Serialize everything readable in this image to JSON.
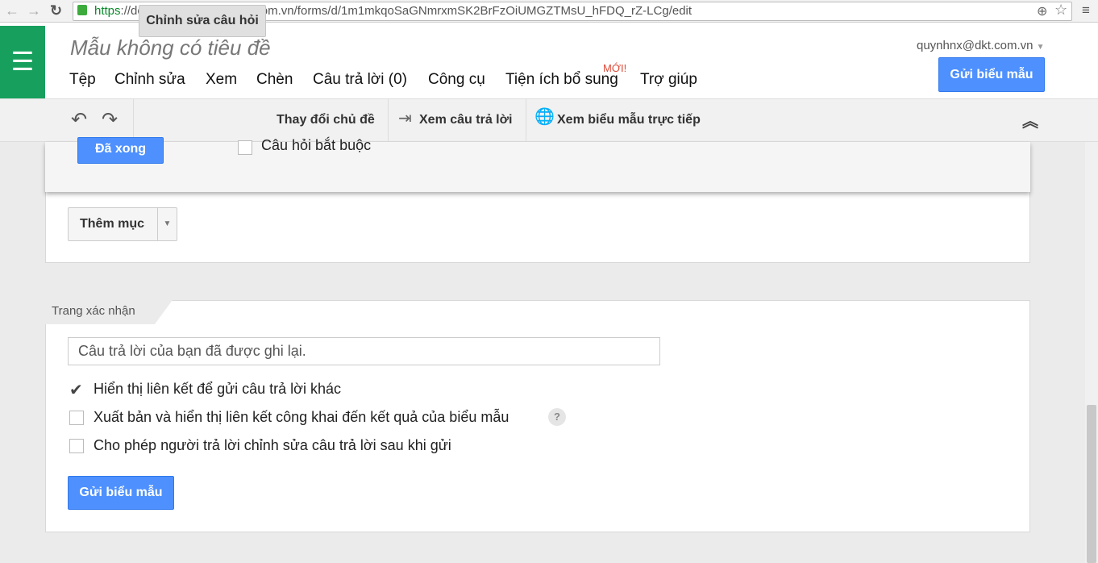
{
  "browser": {
    "url_scheme": "https",
    "url_rest": "://docs.google.com/a/dkt.com.vn/forms/d/1m1mkqoSaGNmrxmSK2BrFzOiUMGZTMsU_hFDQ_rZ-LCg/edit"
  },
  "header": {
    "title": "Mẫu không có tiêu đề",
    "user": "quynhnx@dkt.com.vn",
    "send_label": "Gửi biểu mẫu",
    "new_badge": "MỚI!",
    "menu": [
      "Tệp",
      "Chỉnh sửa",
      "Xem",
      "Chèn",
      "Câu trả lời (0)",
      "Công cụ",
      "Tiện ích bổ sung",
      "Trợ giúp"
    ]
  },
  "toolbar": {
    "edit_questions": "Chỉnh sửa câu hỏi",
    "change_theme": "Thay đổi chủ đề",
    "view_responses": "Xem câu trả lời",
    "view_live": "Xem biểu mẫu trực tiếp"
  },
  "question": {
    "done_label": "Đã xong",
    "required_label": "Câu hỏi bắt buộc",
    "required_checked": false
  },
  "add_item": {
    "label": "Thêm mục"
  },
  "confirmation": {
    "tab_label": "Trang xác nhận",
    "message": "Câu trả lời của bạn đã được ghi lại.",
    "options": [
      {
        "label": "Hiển thị liên kết để gửi câu trả lời khác",
        "checked": true
      },
      {
        "label": "Xuất bản và hiển thị liên kết công khai đến kết quả của biểu mẫu",
        "checked": false
      },
      {
        "label": "Cho phép người trả lời chỉnh sửa câu trả lời sau khi gửi",
        "checked": false
      }
    ],
    "help": "?",
    "send_label": "Gửi biểu mẫu"
  }
}
